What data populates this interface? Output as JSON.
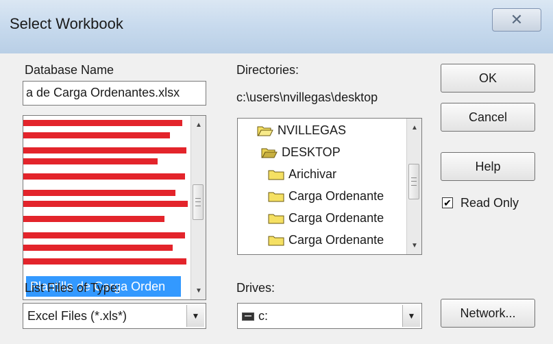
{
  "window": {
    "title": "Select Workbook",
    "close_label": "✕"
  },
  "database": {
    "label": "Database Name",
    "value": "a de Carga Ordenantes.xlsx",
    "selected_item": "Plantilla de Carga Orden"
  },
  "directories": {
    "label": "Directories:",
    "path": "c:\\users\\nvillegas\\desktop",
    "items": [
      {
        "name": "NVILLEGAS",
        "state": "open"
      },
      {
        "name": "DESKTOP",
        "state": "open"
      },
      {
        "name": "Arichivar",
        "state": "closed"
      },
      {
        "name": "Carga Ordenante",
        "state": "closed"
      },
      {
        "name": "Carga Ordenante",
        "state": "closed"
      },
      {
        "name": "Carga Ordenante",
        "state": "closed"
      }
    ]
  },
  "buttons": {
    "ok": "OK",
    "cancel": "Cancel",
    "help": "Help",
    "network": "Network..."
  },
  "read_only": {
    "label": "Read Only",
    "checked": true,
    "check_glyph": "✔"
  },
  "file_type": {
    "label": "List Files of Type:",
    "value": "Excel Files (*.xls*)"
  },
  "drives": {
    "label": "Drives:",
    "value": "c:"
  },
  "icons": {
    "arrow_up": "▲",
    "arrow_down": "▼"
  },
  "colors": {
    "selection": "#3399ff",
    "folder": "#f5e063",
    "redaction": "#e3242b"
  }
}
